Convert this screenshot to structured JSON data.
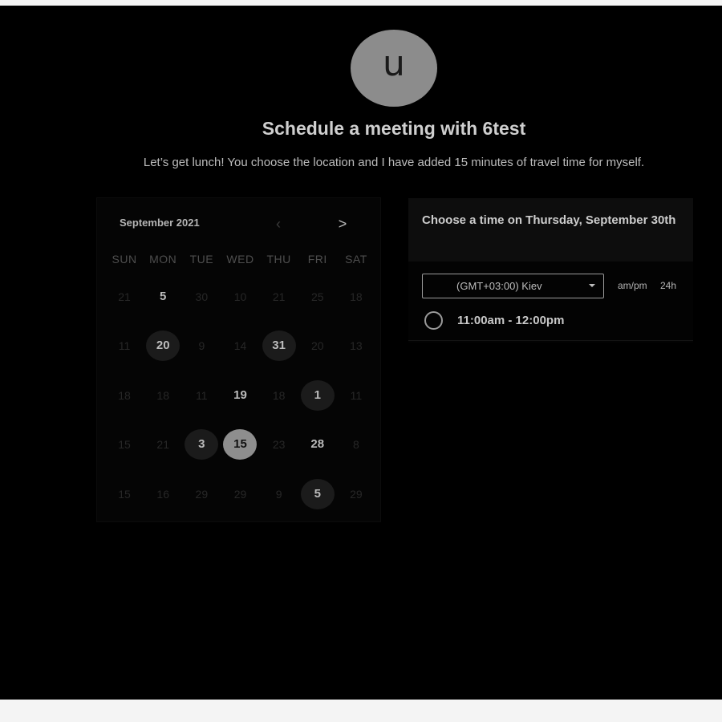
{
  "host": {
    "avatar_letter": "u",
    "title": "Schedule a meeting with 6test",
    "description": "Let’s get lunch! You choose the location and I have added 15 minutes of travel time for myself."
  },
  "calendar": {
    "month_label": "September 2021",
    "prev_icon": "‹",
    "next_icon": ">",
    "weekdays": [
      "SUN",
      "MON",
      "TUE",
      "WED",
      "THU",
      "FRI",
      "SAT"
    ],
    "days": [
      {
        "label": "21",
        "state": "dim"
      },
      {
        "label": "5",
        "state": "avail"
      },
      {
        "label": "30",
        "state": "dim"
      },
      {
        "label": "10",
        "state": "dim"
      },
      {
        "label": "21",
        "state": "dim"
      },
      {
        "label": "25",
        "state": "dim"
      },
      {
        "label": "18",
        "state": "dim"
      },
      {
        "label": "11",
        "state": "dim"
      },
      {
        "label": "20",
        "state": "hl"
      },
      {
        "label": "9",
        "state": "dim"
      },
      {
        "label": "14",
        "state": "dim"
      },
      {
        "label": "31",
        "state": "hl"
      },
      {
        "label": "20",
        "state": "dim"
      },
      {
        "label": "13",
        "state": "dim"
      },
      {
        "label": "18",
        "state": "dim"
      },
      {
        "label": "18",
        "state": "dim"
      },
      {
        "label": "11",
        "state": "dim"
      },
      {
        "label": "19",
        "state": "avail"
      },
      {
        "label": "18",
        "state": "dim"
      },
      {
        "label": "1",
        "state": "hl"
      },
      {
        "label": "11",
        "state": "dim"
      },
      {
        "label": "15",
        "state": "dim"
      },
      {
        "label": "21",
        "state": "dim"
      },
      {
        "label": "3",
        "state": "hl"
      },
      {
        "label": "15",
        "state": "sel"
      },
      {
        "label": "23",
        "state": "dim"
      },
      {
        "label": "28",
        "state": "avail"
      },
      {
        "label": "8",
        "state": "dim"
      },
      {
        "label": "15",
        "state": "dim"
      },
      {
        "label": "16",
        "state": "dim"
      },
      {
        "label": "29",
        "state": "dim"
      },
      {
        "label": "29",
        "state": "dim"
      },
      {
        "label": "9",
        "state": "dim"
      },
      {
        "label": "5",
        "state": "hl"
      },
      {
        "label": "29",
        "state": "dim"
      }
    ]
  },
  "time_panel": {
    "title": "Choose a time on Thursday, September 30th",
    "timezone": "(GMT+03:00) Kiev",
    "format_ampm": "am/pm",
    "format_24": "24h",
    "slot": "11:00am - 12:00pm"
  }
}
